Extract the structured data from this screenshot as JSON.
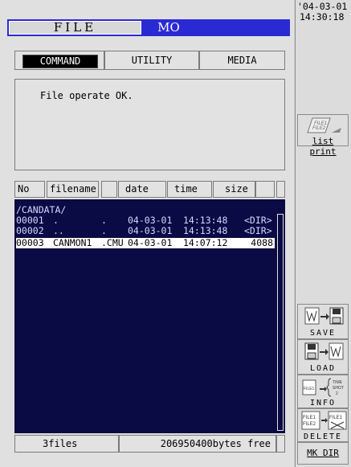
{
  "header": {
    "file_label": "FILE",
    "media_label": "MO"
  },
  "tabs": [
    "COMMAND",
    "UTILITY",
    "MEDIA"
  ],
  "message": "File operate OK.",
  "columns": [
    "No",
    "filename",
    "date",
    "time",
    "size"
  ],
  "path": "/CANDATA/",
  "rows": [
    {
      "no": "00001",
      "name": ".",
      "ext": ".",
      "date": "04-03-01",
      "time": "14:13:48",
      "size": "<DIR>",
      "selected": false
    },
    {
      "no": "00002",
      "name": "..",
      "ext": ".",
      "date": "04-03-01",
      "time": "14:13:48",
      "size": "<DIR>",
      "selected": false
    },
    {
      "no": "00003",
      "name": "CANMON1",
      "ext": ".CMU",
      "date": "04-03-01",
      "time": "14:07:12",
      "size": "4088",
      "selected": true
    }
  ],
  "footer": {
    "files": "3files",
    "free": "206950400bytes free"
  },
  "clock": {
    "date": "'04-03-01",
    "time": "14:30:18"
  },
  "sidebar": {
    "list_print": "list print",
    "save": "SAVE",
    "load": "LOAD",
    "info": "INFO",
    "delete": "DELETE",
    "mkdir": "MK DIR"
  }
}
